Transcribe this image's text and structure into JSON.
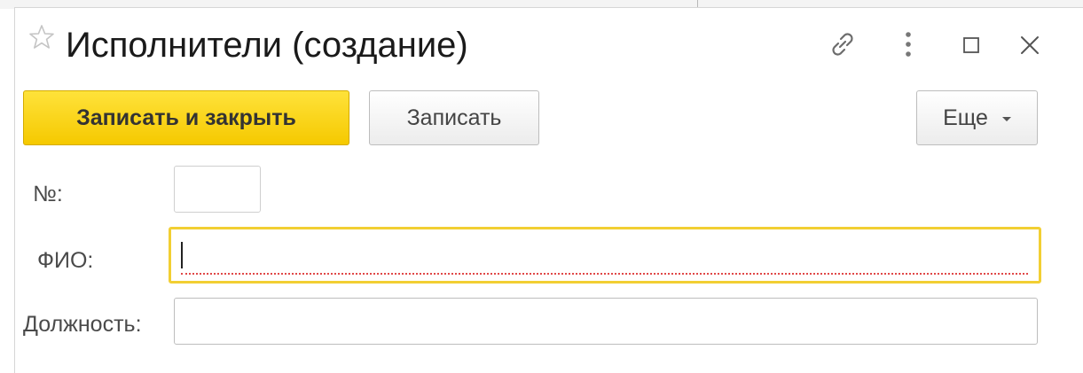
{
  "window": {
    "title": "Исполнители (создание)"
  },
  "header_icons": {
    "favorite": "star-icon",
    "link": "link-icon",
    "menu": "more-vertical-icon",
    "maximize": "maximize-icon",
    "close": "close-icon"
  },
  "toolbar": {
    "save_close_label": "Записать и закрыть",
    "save_label": "Записать",
    "more_label": "Еще"
  },
  "form": {
    "number_label": "№:",
    "number_value": "",
    "fio_label": "ФИО:",
    "fio_value": "",
    "position_label": "Должность:",
    "position_value": ""
  },
  "colors": {
    "primary_button": "#f5c900",
    "focus_border": "#f2cf33",
    "required_underline": "#e04848"
  }
}
